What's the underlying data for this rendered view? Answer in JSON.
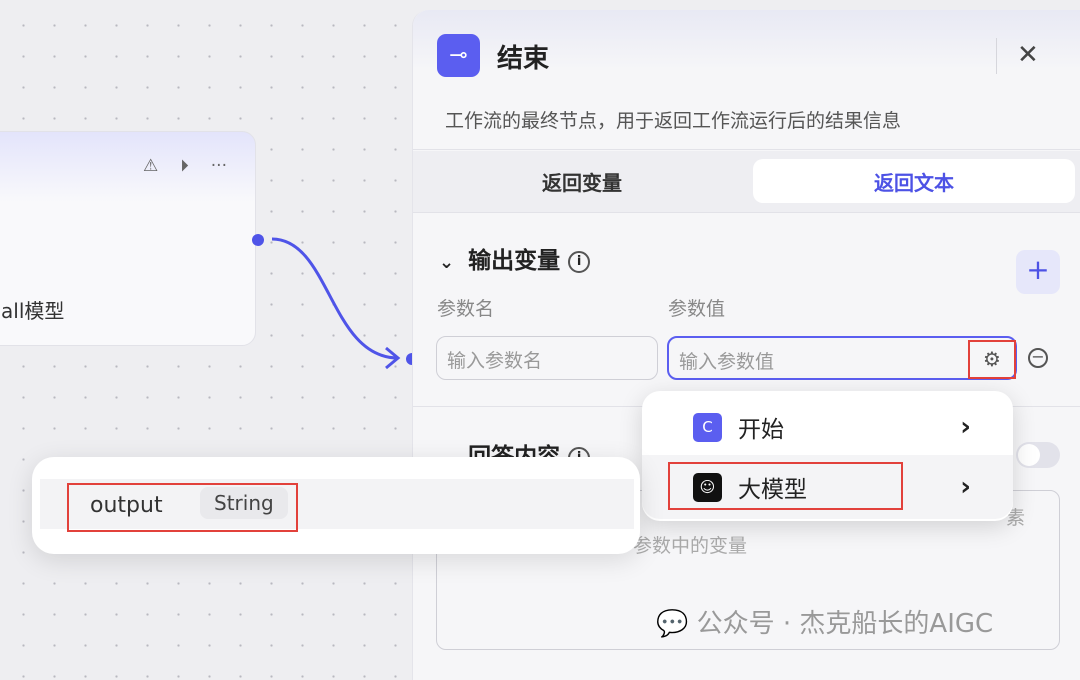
{
  "canvas": {
    "node": {
      "label": "all模型",
      "icons": [
        "alert-off-icon",
        "play-icon",
        "more-icon"
      ]
    }
  },
  "panel": {
    "title": "结束",
    "description": "工作流的最终节点，用于返回工作流运行后的结果信息",
    "tabs": [
      {
        "label": "返回变量"
      },
      {
        "label": "返回文本"
      }
    ],
    "output_section": {
      "title": "输出变量",
      "col_name": "参数名",
      "col_value": "参数值",
      "name_placeholder": "输入参数名",
      "value_placeholder": "输入参数值"
    },
    "answer_section": {
      "title": "回答内容",
      "placeholder_fragment_1": "素",
      "placeholder_fragment_2": "参数中的变量"
    }
  },
  "menu": {
    "items": [
      {
        "label": "开始"
      },
      {
        "label": "大模型"
      }
    ]
  },
  "tooltip": {
    "name": "output",
    "type": "String"
  },
  "watermark": "公众号 · 杰克船长的AIGC",
  "colors": {
    "accent": "#4f54e8",
    "highlight": "#e2413b"
  }
}
